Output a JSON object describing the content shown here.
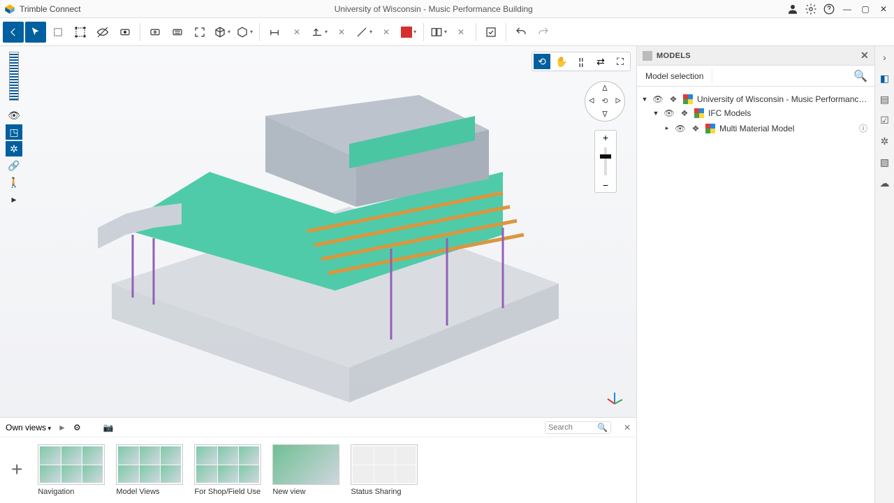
{
  "app": {
    "name": "Trimble Connect",
    "document_title": "University of Wisconsin - Music Performance Building"
  },
  "models_panel": {
    "title": "MODELS",
    "tab_label": "Model selection",
    "tree": {
      "root": {
        "label": "University of Wisconsin - Music Performance Building"
      },
      "group": {
        "label": "IFC Models"
      },
      "item": {
        "label": "Multi Material Model"
      }
    }
  },
  "viewsbar": {
    "dropdown_label": "Own views",
    "search_placeholder": "Search",
    "cards": [
      {
        "label": "Navigation"
      },
      {
        "label": "Model Views"
      },
      {
        "label": "For Shop/Field Use"
      },
      {
        "label": "New view"
      },
      {
        "label": "Status Sharing"
      }
    ]
  },
  "colors": {
    "primary": "#005F9E",
    "red": "#d32f2f"
  }
}
